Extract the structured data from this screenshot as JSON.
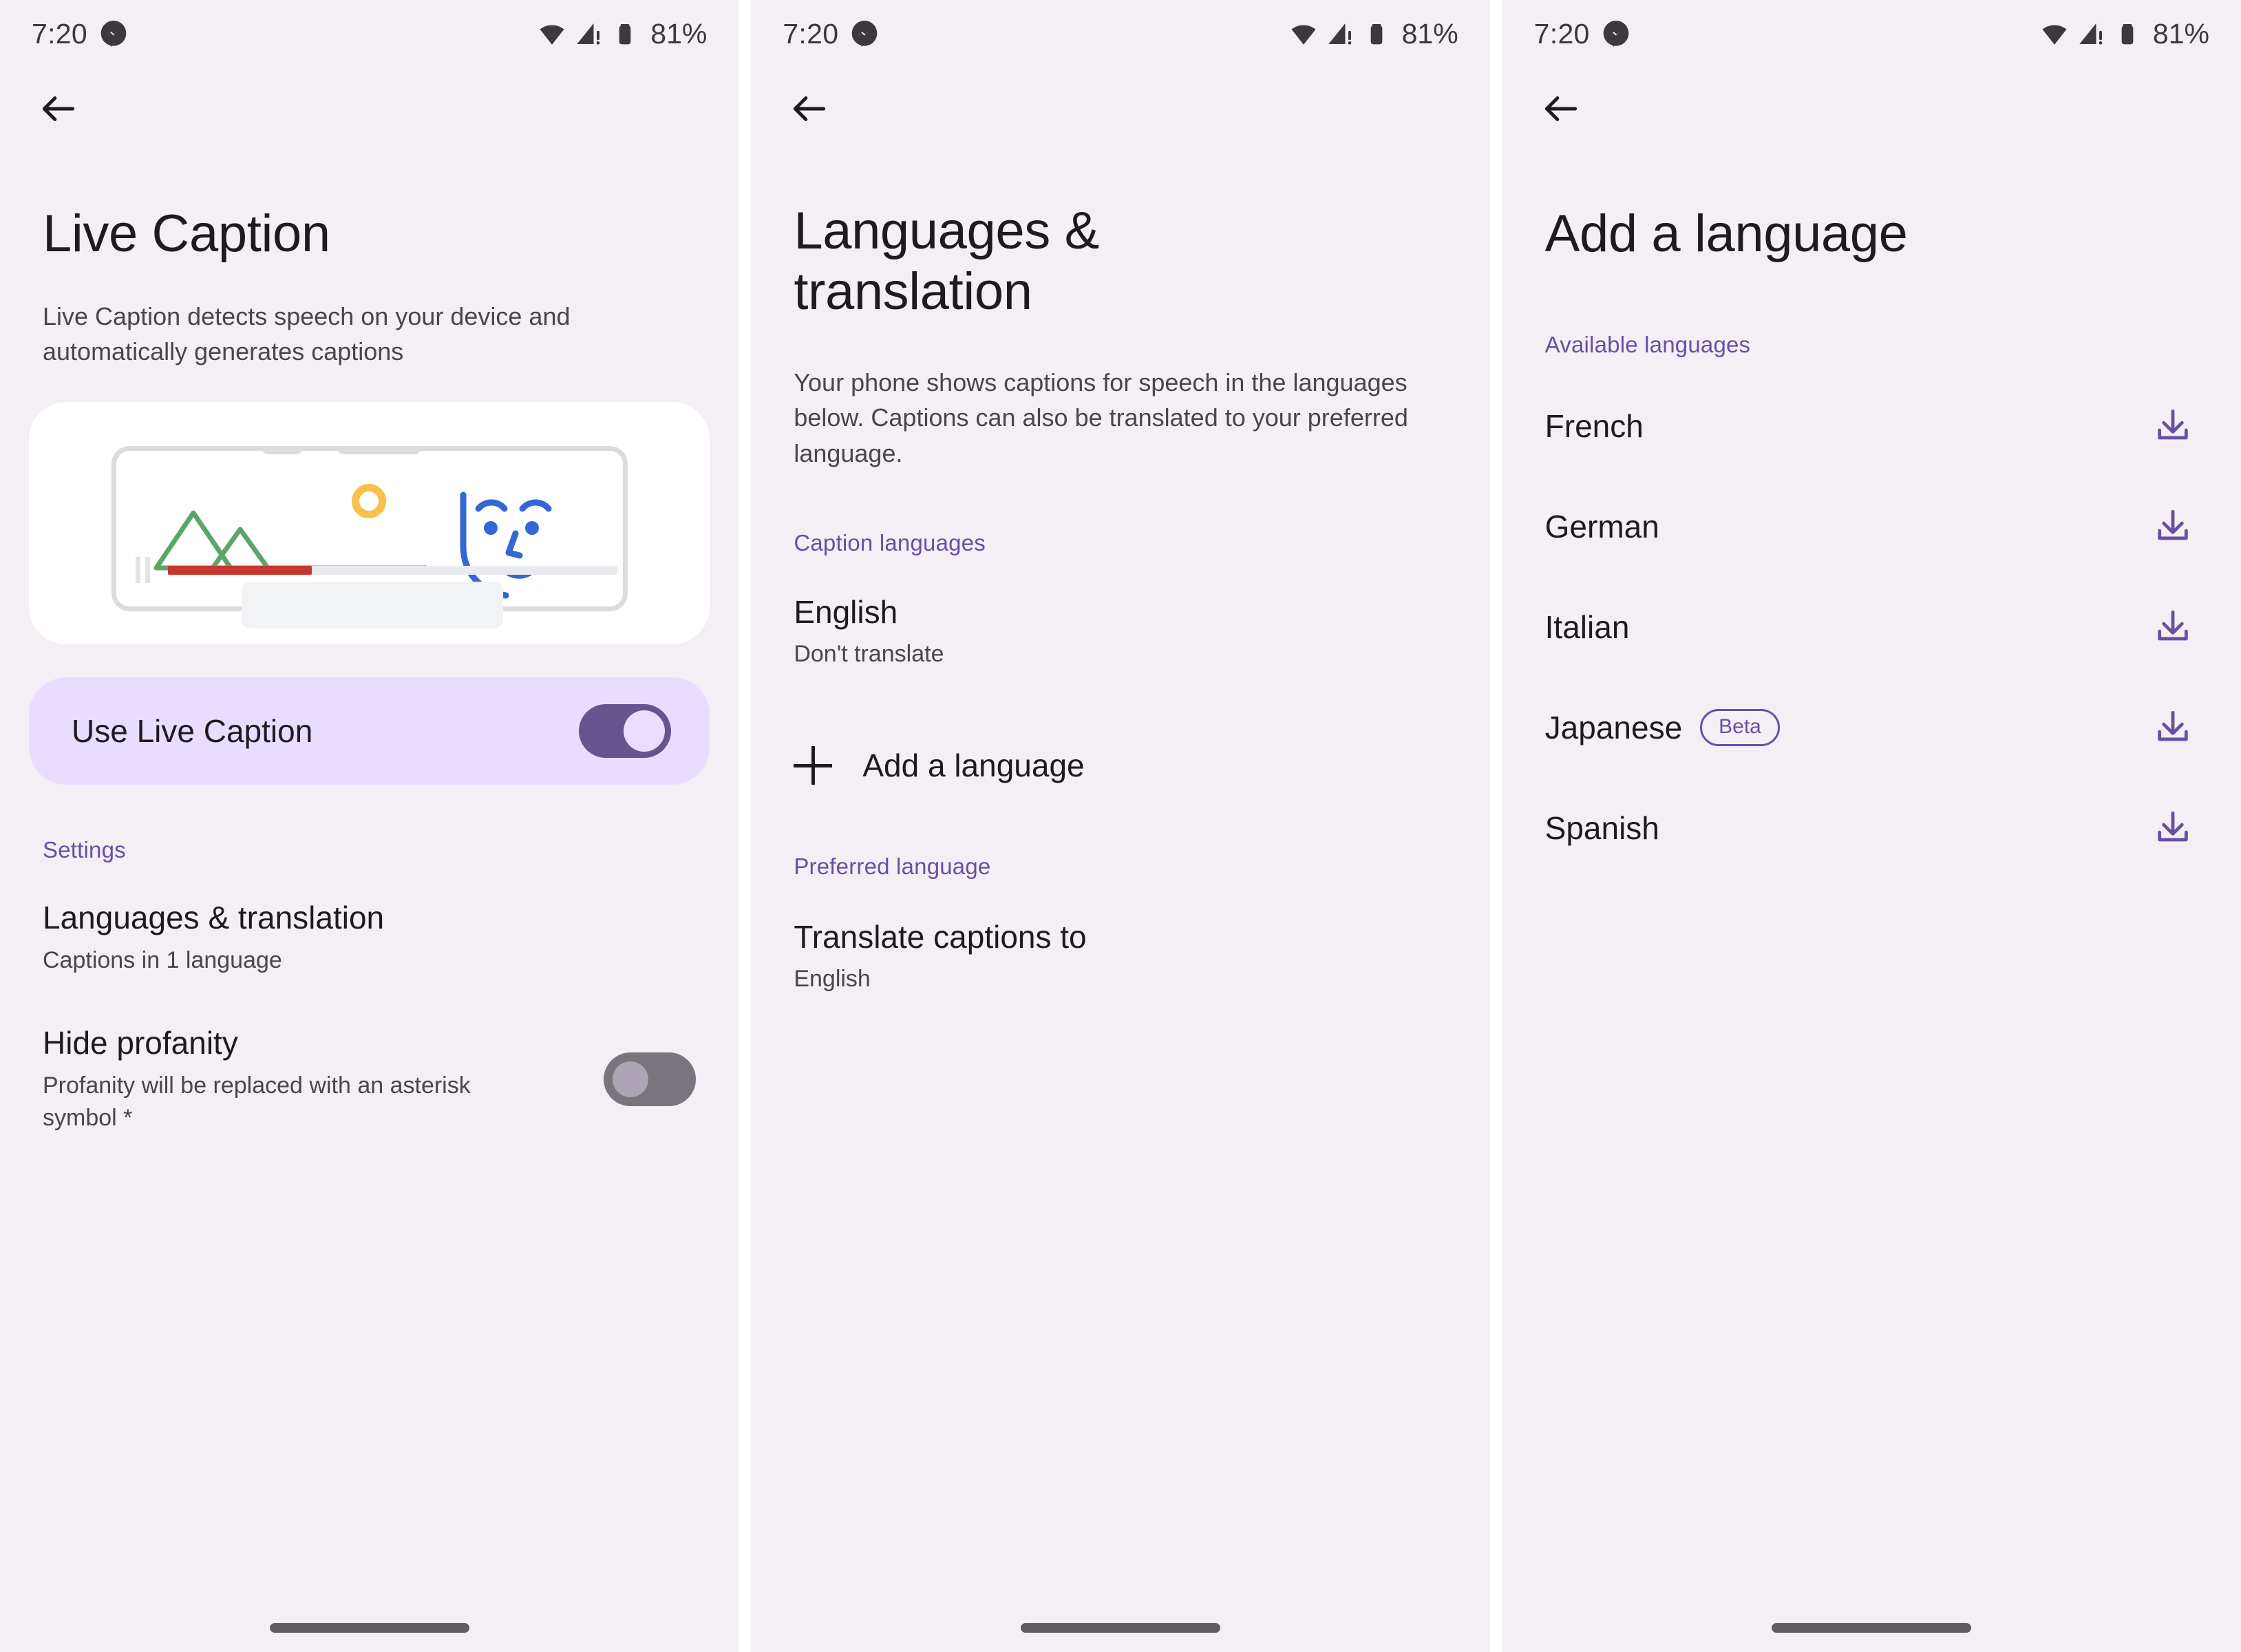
{
  "status_bar": {
    "time": "7:20",
    "messenger_icon": "messenger-icon",
    "wifi_icon": "wifi-icon",
    "signal_icon": "cellular-signal-warning-icon",
    "battery_icon": "battery-icon",
    "battery_text": "81%"
  },
  "colors": {
    "background": "#F4EFF4",
    "accent_purple": "#6750A4",
    "toggle_on": "#65558F",
    "toggle_card": "#E9DDFF",
    "text_primary": "#1D1B20",
    "text_secondary": "#49454F",
    "progress_red": "#C5362C",
    "mountain_green": "#5BA667",
    "sun_yellow": "#F9C04A",
    "face_blue": "#3367D6"
  },
  "screen1": {
    "back_icon": "back-arrow-icon",
    "title": "Live Caption",
    "description": "Live Caption detects speech on your device and automatically generates captions",
    "illustration": {
      "name": "live-caption-illustration",
      "progress_percent": 32,
      "pause_icon": "pause-icon",
      "mountains_icon": "mountains-icon",
      "sun_icon": "sun-icon",
      "face_icon": "face-icon",
      "caption_placeholder": "caption-placeholder-box"
    },
    "use_live_caption": {
      "label": "Use Live Caption",
      "toggle_state": "on"
    },
    "settings_label": "Settings",
    "items": [
      {
        "title": "Languages & translation",
        "subtitle": "Captions in 1 language"
      },
      {
        "title": "Hide profanity",
        "subtitle": "Profanity will be replaced with an asterisk symbol *",
        "toggle_state": "off"
      }
    ]
  },
  "screen2": {
    "back_icon": "back-arrow-icon",
    "title": "Languages & translation",
    "description": "Your phone shows captions for speech in the languages below. Captions can also be translated to your preferred language.",
    "caption_languages_label": "Caption languages",
    "caption_languages": [
      {
        "title": "English",
        "subtitle": "Don't translate"
      }
    ],
    "add_language": {
      "label": "Add a language",
      "icon": "plus-icon"
    },
    "preferred_language_label": "Preferred language",
    "preferred_language": {
      "title": "Translate captions to",
      "subtitle": "English"
    }
  },
  "screen3": {
    "back_icon": "back-arrow-icon",
    "title": "Add a language",
    "available_languages_label": "Available languages",
    "languages": [
      {
        "name": "French",
        "badge": null,
        "download_icon": "download-icon"
      },
      {
        "name": "German",
        "badge": null,
        "download_icon": "download-icon"
      },
      {
        "name": "Italian",
        "badge": null,
        "download_icon": "download-icon"
      },
      {
        "name": "Japanese",
        "badge": "Beta",
        "download_icon": "download-icon"
      },
      {
        "name": "Spanish",
        "badge": null,
        "download_icon": "download-icon"
      }
    ]
  }
}
